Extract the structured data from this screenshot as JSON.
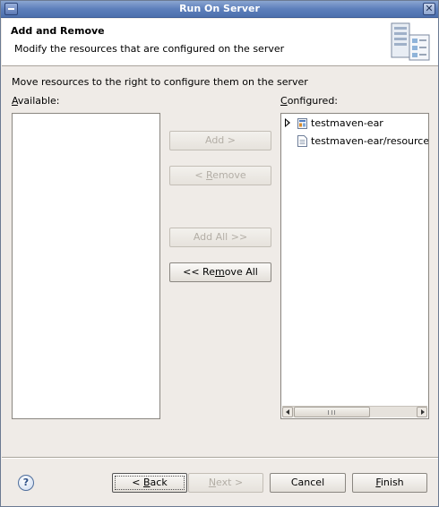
{
  "window": {
    "title": "Run On Server",
    "close_glyph": "✕"
  },
  "banner": {
    "title": "Add and Remove",
    "description": "Modify the resources that are configured on the server",
    "icon": "server-icon"
  },
  "instructions": "Move resources to the right to configure them on the server",
  "available": {
    "label_accel": "A",
    "label_rest": "vailable:",
    "items": []
  },
  "configured": {
    "label_accel": "C",
    "label_rest": "onfigured:",
    "items": [
      {
        "label": "testmaven-ear",
        "icon": "ear-project-icon",
        "expandable": true
      },
      {
        "label": "testmaven-ear/resources/",
        "icon": "file-icon",
        "expandable": false
      }
    ]
  },
  "move_buttons": {
    "add": "Add >",
    "remove_pre": "< ",
    "remove_accel": "R",
    "remove_post": "emove",
    "add_all": "Add All >>",
    "remove_all_pre": "<< Re",
    "remove_all_accel": "m",
    "remove_all_post": "ove All"
  },
  "footer": {
    "help_glyph": "?",
    "back_pre": "< ",
    "back_accel": "B",
    "back_post": "ack",
    "next_accel": "N",
    "next_post": "ext >",
    "cancel": "Cancel",
    "finish_accel": "F",
    "finish_post": "inish"
  },
  "colors": {
    "titlebar": "#5d7fbb",
    "dialog_bg": "#efebe7",
    "disabled_text": "#b3aea6"
  }
}
